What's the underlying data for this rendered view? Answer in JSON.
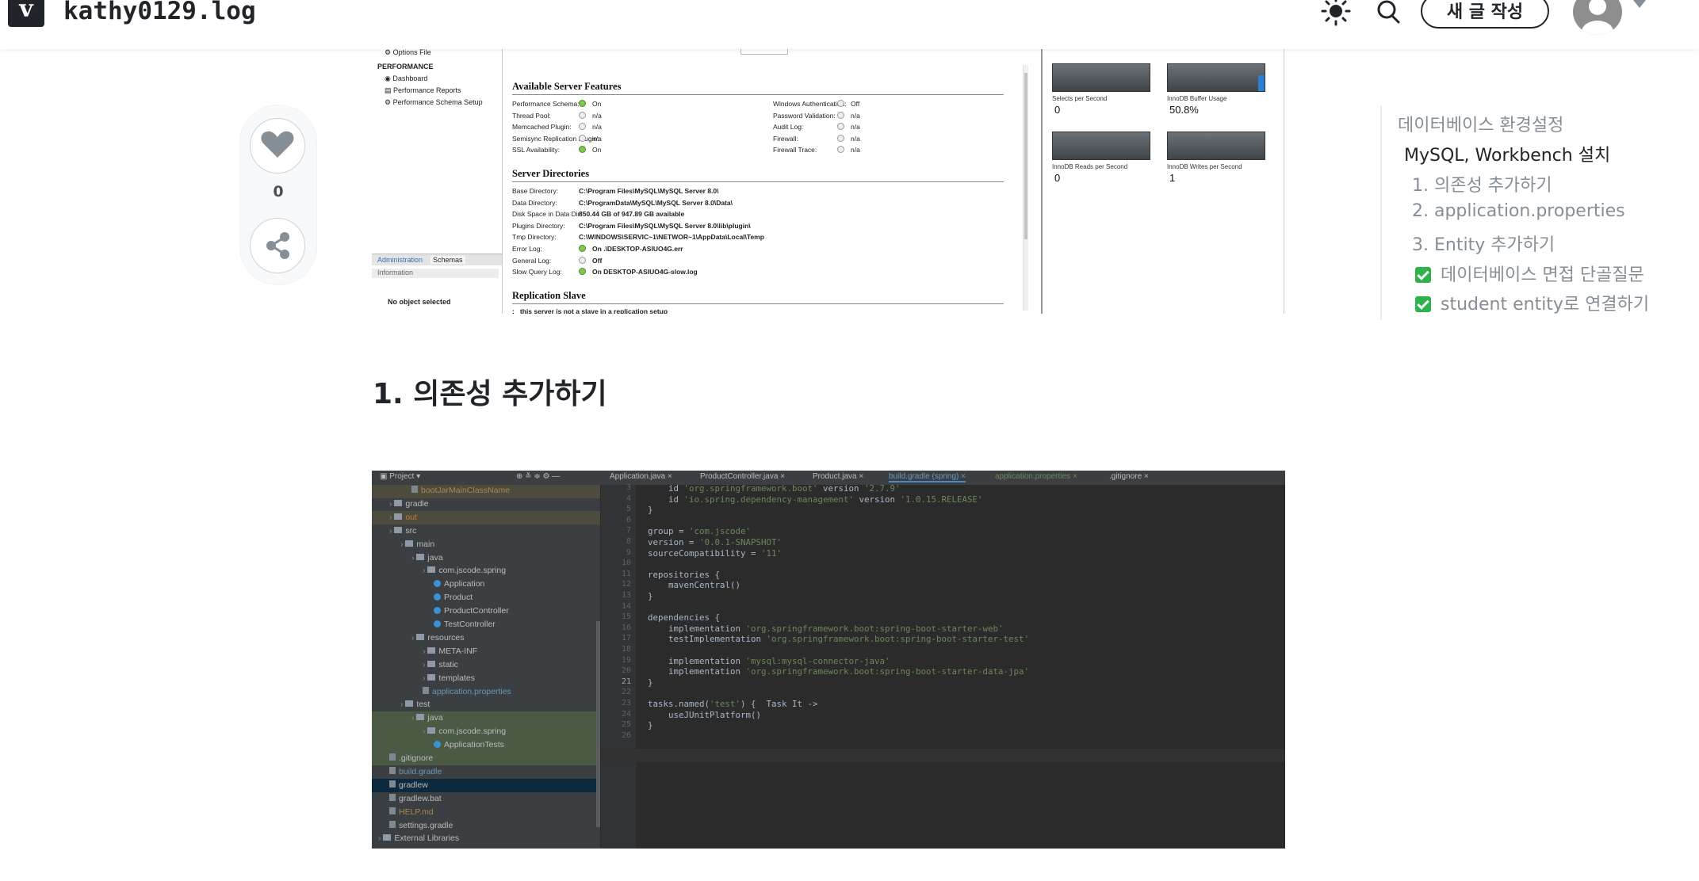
{
  "header": {
    "logo_letter": "v",
    "blog_title": "kathy0129.log",
    "theme_icon": "sun-icon",
    "search_icon": "search-icon",
    "write_button": "새 글 작성",
    "avatar_icon": "user-avatar-icon",
    "menu_icon": "caret-down-icon"
  },
  "sidebar": {
    "like_icon": "heart-icon",
    "like_count": "0",
    "share_icon": "share-icon"
  },
  "toc": {
    "items": [
      {
        "label": "데이터베이스 환경설정",
        "level": 1,
        "checked": false
      },
      {
        "label": "MySQL, Workbench 설치",
        "level": 2,
        "checked": false
      },
      {
        "label": "1. 의존성 추가하기",
        "level": 3,
        "checked": false
      },
      {
        "label": "2. application.properties",
        "level": 3,
        "checked": false
      },
      {
        "label": "3. Entity 추가하기",
        "level": 3,
        "checked": false
      },
      {
        "label": "데이터베이스 면접 단골질문",
        "level": 3,
        "checked": true
      },
      {
        "label": "student entity로 연결하기",
        "level": 3,
        "checked": true
      }
    ]
  },
  "workbench": {
    "nav_items": [
      "Options File",
      "PERFORMANCE",
      "Dashboard",
      "Performance Reports",
      "Performance Schema Setup"
    ],
    "tabs": [
      "Administration",
      "Schemas"
    ],
    "info_label": "Information",
    "no_object": "No object selected",
    "features_title": "Available Server Features",
    "features_left": [
      {
        "label": "Performance Schema:",
        "value": "On",
        "on": true
      },
      {
        "label": "Thread Pool:",
        "value": "n/a",
        "on": false
      },
      {
        "label": "Memcached Plugin:",
        "value": "n/a",
        "on": false
      },
      {
        "label": "Semisync Replication Plugin:",
        "value": "n/a",
        "on": false
      },
      {
        "label": "SSL Availability:",
        "value": "On",
        "on": true
      }
    ],
    "features_right": [
      {
        "label": "Windows Authentication:",
        "value": "Off",
        "on": false
      },
      {
        "label": "Password Validation:",
        "value": "n/a",
        "on": false
      },
      {
        "label": "Audit Log:",
        "value": "n/a",
        "on": false
      },
      {
        "label": "Firewall:",
        "value": "n/a",
        "on": false
      },
      {
        "label": "Firewall Trace:",
        "value": "n/a",
        "on": false
      }
    ],
    "dirs_title": "Server Directories",
    "dirs": [
      {
        "label": "Base Directory:",
        "value": "C:\\Program Files\\MySQL\\MySQL Server 8.0\\"
      },
      {
        "label": "Data Directory:",
        "value": "C:\\ProgramData\\MySQL\\MySQL Server 8.0\\Data\\"
      },
      {
        "label": "Disk Space in Data Dir:",
        "value": "850.44 GB of 947.89 GB available"
      },
      {
        "label": "Plugins Directory:",
        "value": "C:\\Program Files\\MySQL\\MySQL Server 8.0\\lib\\plugin\\"
      },
      {
        "label": "Tmp Directory:",
        "value": "C:\\WINDOWS\\SERVIC~1\\NETWOR~1\\AppData\\Local\\Temp"
      }
    ],
    "logs": [
      {
        "label": "Error Log:",
        "value": "On   .\\DESKTOP-ASIUO4G.err",
        "on": true
      },
      {
        "label": "General Log:",
        "value": "Off",
        "on": false
      },
      {
        "label": "Slow Query Log:",
        "value": "On   DESKTOP-ASIUO4G-slow.log",
        "on": true
      }
    ],
    "replication_title": "Replication Slave",
    "replication_text": "this server is not a slave in a replication setup",
    "gauges": [
      {
        "label": "Selects per Second",
        "value": "0"
      },
      {
        "label": "InnoDB Buffer Usage",
        "value": "50.8%"
      },
      {
        "label": "InnoDB Reads per Second",
        "value": "0"
      },
      {
        "label": "InnoDB Writes per Second",
        "value": "1"
      }
    ]
  },
  "section_heading": "1. 의존성 추가하기",
  "ide": {
    "tabs": [
      "Project",
      "Application.java",
      "ProductController.java",
      "Product.java",
      "build.gradle (spring)",
      "application.properties",
      ".gitignore"
    ],
    "tree": [
      {
        "label": "bootJarMainClassName",
        "indent": 3,
        "kind": "file",
        "color": "#a58a4a"
      },
      {
        "label": "gradle",
        "indent": 1,
        "kind": "folder",
        "color": "#bbbbbb"
      },
      {
        "label": "out",
        "indent": 1,
        "kind": "folder",
        "color": "#c07a3c"
      },
      {
        "label": "src",
        "indent": 1,
        "kind": "folder",
        "color": "#bbbbbb"
      },
      {
        "label": "main",
        "indent": 2,
        "kind": "folder",
        "color": "#bbbbbb"
      },
      {
        "label": "java",
        "indent": 3,
        "kind": "folder",
        "color": "#bbbbbb"
      },
      {
        "label": "com.jscode.spring",
        "indent": 4,
        "kind": "folder",
        "color": "#bbbbbb"
      },
      {
        "label": "Application",
        "indent": 5,
        "kind": "class",
        "color": "#bbbbbb"
      },
      {
        "label": "Product",
        "indent": 5,
        "kind": "class",
        "color": "#bbbbbb"
      },
      {
        "label": "ProductController",
        "indent": 5,
        "kind": "class",
        "color": "#bbbbbb"
      },
      {
        "label": "TestController",
        "indent": 5,
        "kind": "class",
        "color": "#bbbbbb"
      },
      {
        "label": "resources",
        "indent": 3,
        "kind": "folder",
        "color": "#bbbbbb"
      },
      {
        "label": "META-INF",
        "indent": 4,
        "kind": "folder",
        "color": "#bbbbbb"
      },
      {
        "label": "static",
        "indent": 4,
        "kind": "folder",
        "color": "#bbbbbb"
      },
      {
        "label": "templates",
        "indent": 4,
        "kind": "folder",
        "color": "#bbbbbb"
      },
      {
        "label": "application.properties",
        "indent": 4,
        "kind": "file",
        "color": "#6897bb"
      },
      {
        "label": "test",
        "indent": 2,
        "kind": "folder",
        "color": "#bbbbbb"
      },
      {
        "label": "java",
        "indent": 3,
        "kind": "folder",
        "color": "#bbbbbb"
      },
      {
        "label": "com.jscode.spring",
        "indent": 4,
        "kind": "folder",
        "color": "#bbbbbb"
      },
      {
        "label": "ApplicationTests",
        "indent": 5,
        "kind": "class",
        "color": "#bbbbbb"
      },
      {
        "label": ".gitignore",
        "indent": 1,
        "kind": "file",
        "color": "#bbbbbb"
      },
      {
        "label": "build.gradle",
        "indent": 1,
        "kind": "file",
        "color": "#6897bb"
      },
      {
        "label": "gradlew",
        "indent": 1,
        "kind": "file",
        "color": "#bbbbbb"
      },
      {
        "label": "gradlew.bat",
        "indent": 1,
        "kind": "file",
        "color": "#bbbbbb"
      },
      {
        "label": "HELP.md",
        "indent": 1,
        "kind": "file",
        "color": "#a58a4a"
      },
      {
        "label": "settings.gradle",
        "indent": 1,
        "kind": "file",
        "color": "#bbbbbb"
      },
      {
        "label": "External Libraries",
        "indent": 0,
        "kind": "folder",
        "color": "#bbbbbb"
      }
    ],
    "code_lines": [
      {
        "n": "3",
        "text": "    id 'org.springframework.boot' version '2.7.9'"
      },
      {
        "n": "4",
        "text": "    id 'io.spring.dependency-management' version '1.0.15.RELEASE'"
      },
      {
        "n": "5",
        "text": "}"
      },
      {
        "n": "6",
        "text": ""
      },
      {
        "n": "7",
        "text": "group = 'com.jscode'"
      },
      {
        "n": "8",
        "text": "version = '0.0.1-SNAPSHOT'"
      },
      {
        "n": "9",
        "text": "sourceCompatibility = '11'"
      },
      {
        "n": "10",
        "text": ""
      },
      {
        "n": "11",
        "text": "repositories {"
      },
      {
        "n": "12",
        "text": "    mavenCentral()"
      },
      {
        "n": "13",
        "text": "}"
      },
      {
        "n": "14",
        "text": ""
      },
      {
        "n": "15",
        "text": "dependencies {"
      },
      {
        "n": "16",
        "text": "    implementation 'org.springframework.boot:spring-boot-starter-web'"
      },
      {
        "n": "17",
        "text": "    testImplementation 'org.springframework.boot:spring-boot-starter-test'"
      },
      {
        "n": "18",
        "text": ""
      },
      {
        "n": "19",
        "text": "    implementation 'mysql:mysql-connector-java'"
      },
      {
        "n": "20",
        "text": "    implementation 'org.springframework.boot:spring-boot-starter-data-jpa'"
      },
      {
        "n": "21",
        "text": "}"
      },
      {
        "n": "22",
        "text": ""
      },
      {
        "n": "23",
        "text": "tasks.named('test') {  Task It ->"
      },
      {
        "n": "24",
        "text": "    useJUnitPlatform()"
      },
      {
        "n": "25",
        "text": "}"
      },
      {
        "n": "26",
        "text": ""
      }
    ]
  }
}
